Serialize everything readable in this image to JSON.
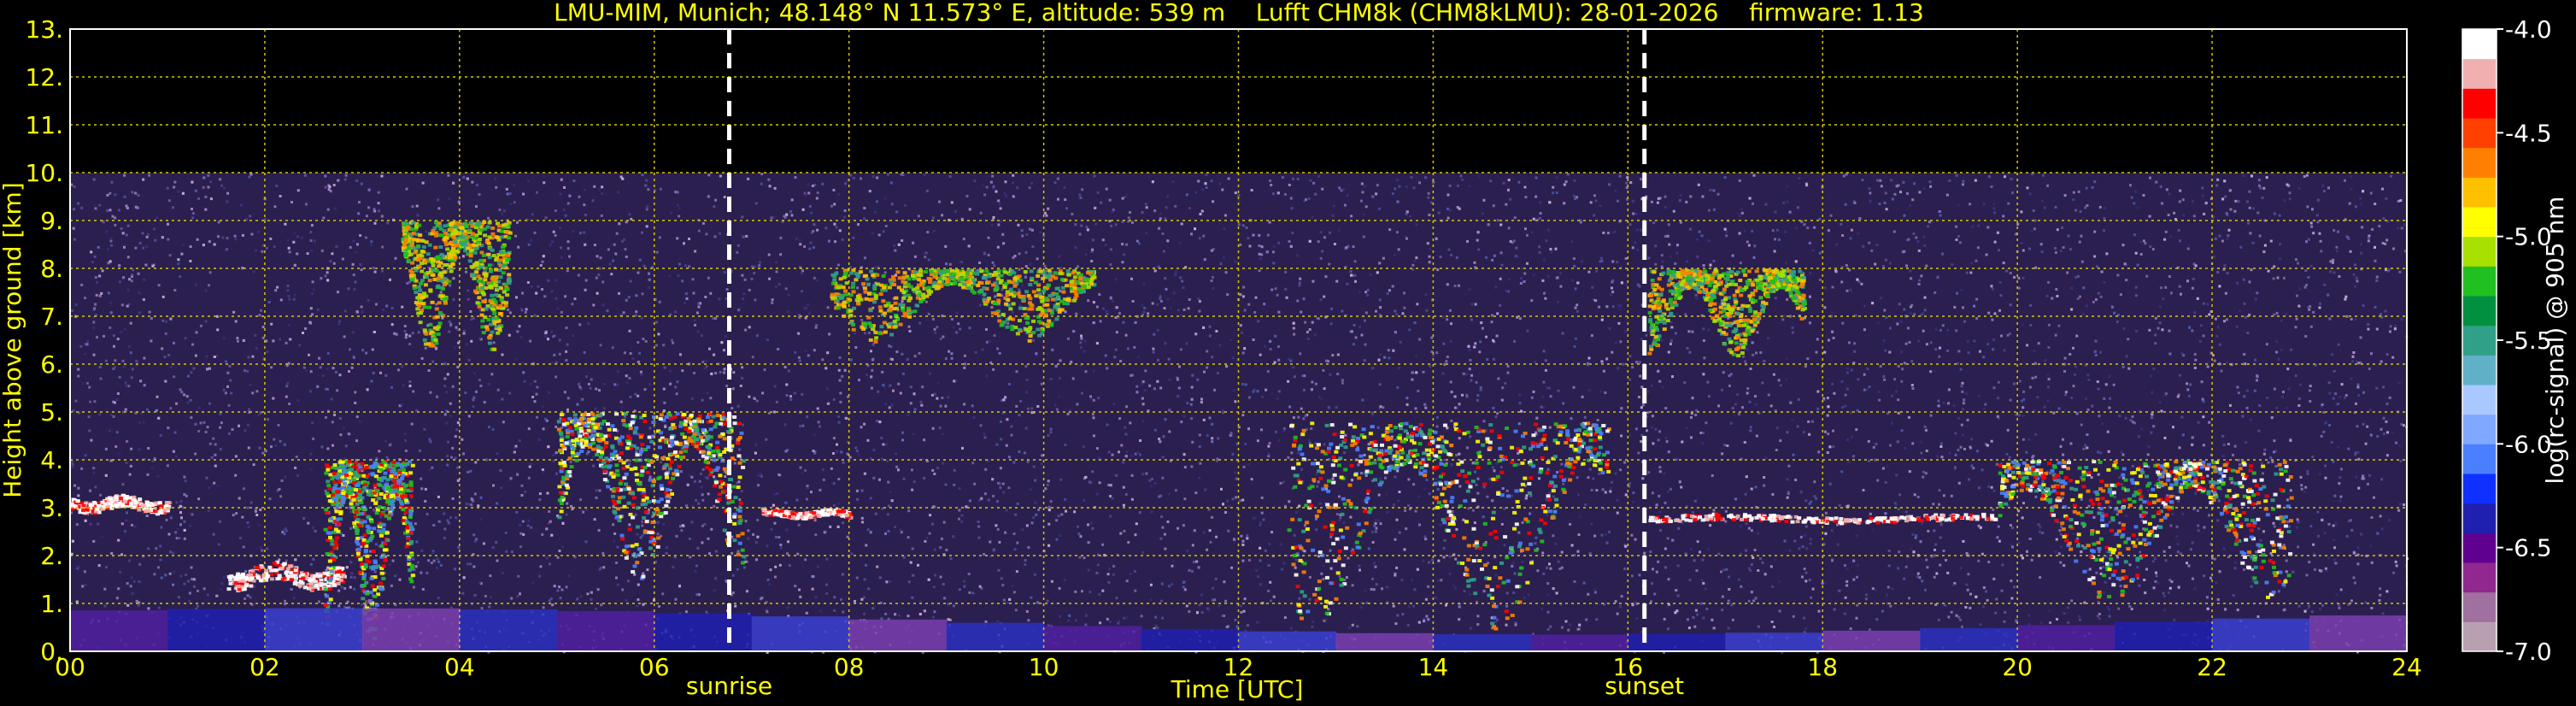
{
  "chart_data": {
    "type": "heatmap",
    "title": "LMU-MIM, Munich; 48.148° N 11.573° E, altitude: 539 m    Lufft CHM8k (CHM8kLMU): 28-01-2026    firmware: 1.13",
    "xlabel": "Time [UTC]",
    "ylabel": "Height above ground [km]",
    "xlim": [
      0,
      24
    ],
    "ylim": [
      0,
      13
    ],
    "x_ticks": [
      "00",
      "02",
      "04",
      "06",
      "08",
      "10",
      "12",
      "14",
      "16",
      "18",
      "20",
      "22",
      "24"
    ],
    "y_ticks": [
      "0.",
      "1.",
      "2.",
      "3.",
      "4.",
      "5.",
      "6.",
      "7.",
      "8.",
      "9.",
      "10.",
      "11.",
      "12.",
      "13."
    ],
    "grid": true,
    "markers": [
      {
        "label": "sunrise",
        "x": 6.77
      },
      {
        "label": "sunset",
        "x": 16.17
      }
    ],
    "colorbar": {
      "label": "log(rc-signal) @ 905 nm",
      "range": [
        -7.0,
        -4.0
      ],
      "ticks": [
        "-4.0",
        "-4.5",
        "-5.0",
        "-5.5",
        "-6.0",
        "-6.5",
        "-7.0"
      ],
      "colors": [
        "#b8a0b0",
        "#a070a0",
        "#902890",
        "#600090",
        "#2020b0",
        "#1030ff",
        "#4a80ff",
        "#80a8ff",
        "#a8c8ff",
        "#60b0c8",
        "#30a088",
        "#009040",
        "#20c020",
        "#a8e000",
        "#ffff00",
        "#ffc000",
        "#ff8000",
        "#ff4000",
        "#ff0000",
        "#f0b0b0",
        "#ffffff"
      ]
    },
    "noise_top_km": 10,
    "features": [
      {
        "kind": "cloud_layer",
        "x": [
          0,
          1.0
        ],
        "y": [
          2.9,
          3.3
        ]
      },
      {
        "kind": "cloud_layer",
        "x": [
          1.6,
          2.8
        ],
        "y": [
          1.3,
          1.9
        ]
      },
      {
        "kind": "precipitation",
        "x": [
          2.6,
          3.5
        ],
        "y": [
          0.2,
          4.0
        ]
      },
      {
        "kind": "mixed_phase_cloud",
        "x": [
          5.0,
          6.9
        ],
        "y": [
          1.5,
          5.0
        ]
      },
      {
        "kind": "cloud_layer",
        "x": [
          7.1,
          8.0
        ],
        "y": [
          2.8,
          3.0
        ]
      },
      {
        "kind": "cirrus",
        "x": [
          3.4,
          4.5
        ],
        "y": [
          6.3,
          9.0
        ]
      },
      {
        "kind": "cirrus",
        "x": [
          7.8,
          10.5
        ],
        "y": [
          6.5,
          8.0
        ]
      },
      {
        "kind": "mixed_phase_cloud",
        "x": [
          12.5,
          15.8
        ],
        "y": [
          0.5,
          4.8
        ]
      },
      {
        "kind": "cirrus",
        "x": [
          16.2,
          17.8
        ],
        "y": [
          6.2,
          8.0
        ]
      },
      {
        "kind": "cloud_layer",
        "x": [
          16.2,
          19.8
        ],
        "y": [
          2.7,
          2.9
        ]
      },
      {
        "kind": "mixed_phase_cloud",
        "x": [
          19.8,
          22.8
        ],
        "y": [
          1.0,
          4.0
        ]
      },
      {
        "kind": "boundary_layer",
        "x": [
          0,
          24
        ],
        "y": [
          0,
          1.0
        ]
      }
    ]
  }
}
